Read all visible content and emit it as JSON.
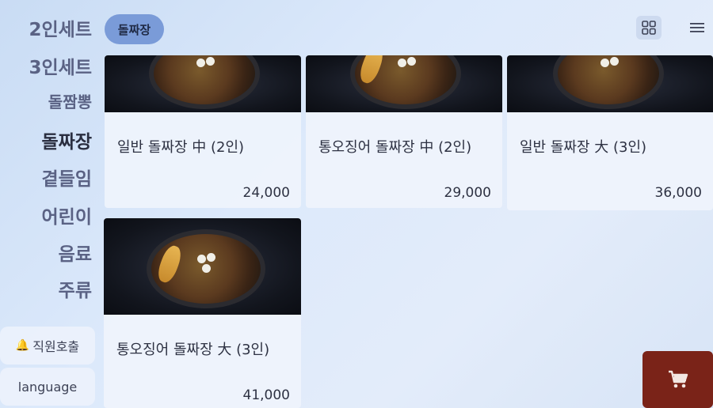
{
  "sidebar": {
    "categories": [
      "2인세트",
      "3인세트",
      "돌짬뽕",
      "돌짜장",
      "곁들임",
      "어린이",
      "음료",
      "주류"
    ],
    "active_category": "돌짜장",
    "staff_call_label": "직원호출",
    "language_label": "language"
  },
  "header": {
    "current_category_chip": "돌짜장"
  },
  "menu_items": [
    {
      "name": "일반 돌짜장 中 (2인)",
      "price": "24,000"
    },
    {
      "name": "통오징어 돌짜장 中 (2인)",
      "price": "29,000"
    },
    {
      "name": "일반 돌짜장 大 (3인)",
      "price": "36,000"
    },
    {
      "name": "통오징어 돌짜장 大 (3인)",
      "price": "41,000"
    }
  ],
  "icons": {
    "grid_view": "grid-icon",
    "menu": "hamburger-icon",
    "cart": "cart-icon",
    "bell": "bell-icon"
  },
  "colors": {
    "chip_bg": "#7a9bd8",
    "cart_bg": "#7a2318"
  }
}
